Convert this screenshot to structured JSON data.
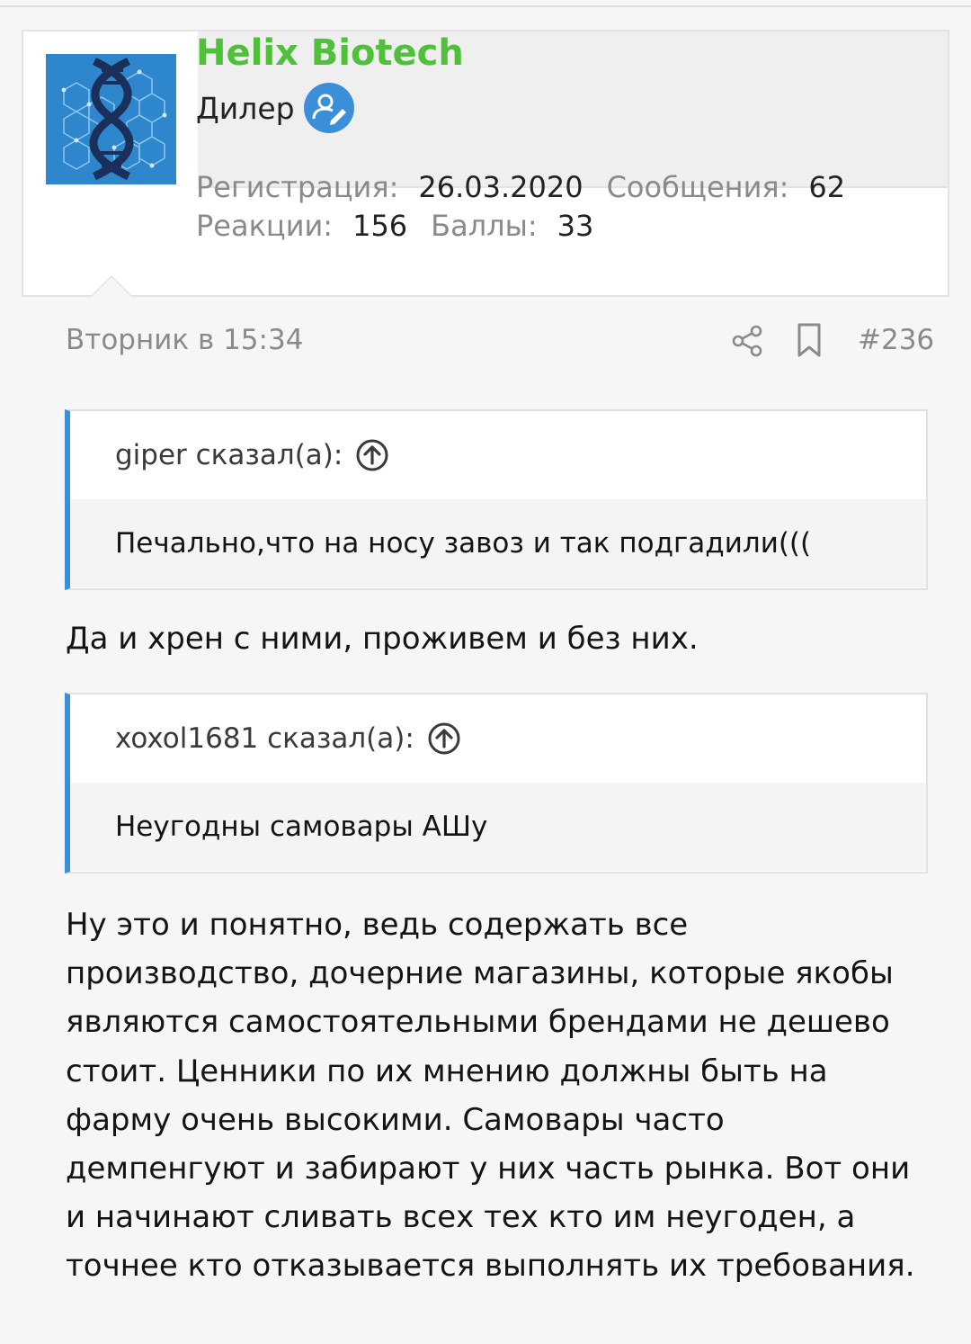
{
  "user": {
    "name": "Helix Biotech",
    "role": "Дилер",
    "role_icon": "user-edit-icon",
    "stats": {
      "registration_label": "Регистрация:",
      "registration_value": "26.03.2020",
      "messages_label": "Сообщения:",
      "messages_value": "62",
      "reactions_label": "Реакции:",
      "reactions_value": "156",
      "points_label": "Баллы:",
      "points_value": "33"
    }
  },
  "post": {
    "date": "Вторник в 15:34",
    "number": "#236",
    "quotes": [
      {
        "author": "giper сказал(а):",
        "text": "Печально,что на носу завоз и так подгадили((("
      },
      {
        "author": "xoxol1681 сказал(а):",
        "text": "Неугодны самовары АШу"
      }
    ],
    "reply1": "Да и хрен с ними, проживем и без них.",
    "reply2": "Ну это и понятно, ведь содержать все производство, дочерние магазины, которые якобы являются самостоятельными брендами не дешево стоит. Ценники по их мнению должны быть на фарму очень высокими. Самовары часто демпенгуют и забирают у них часть рынка. Вот они и начинают сливать всех тех кто им неугоден, а точнее кто отказывается выполнять их требования."
  },
  "colors": {
    "username": "#4fbf3c",
    "accent": "#3b8fd9",
    "muted": "#8a8a8a"
  }
}
